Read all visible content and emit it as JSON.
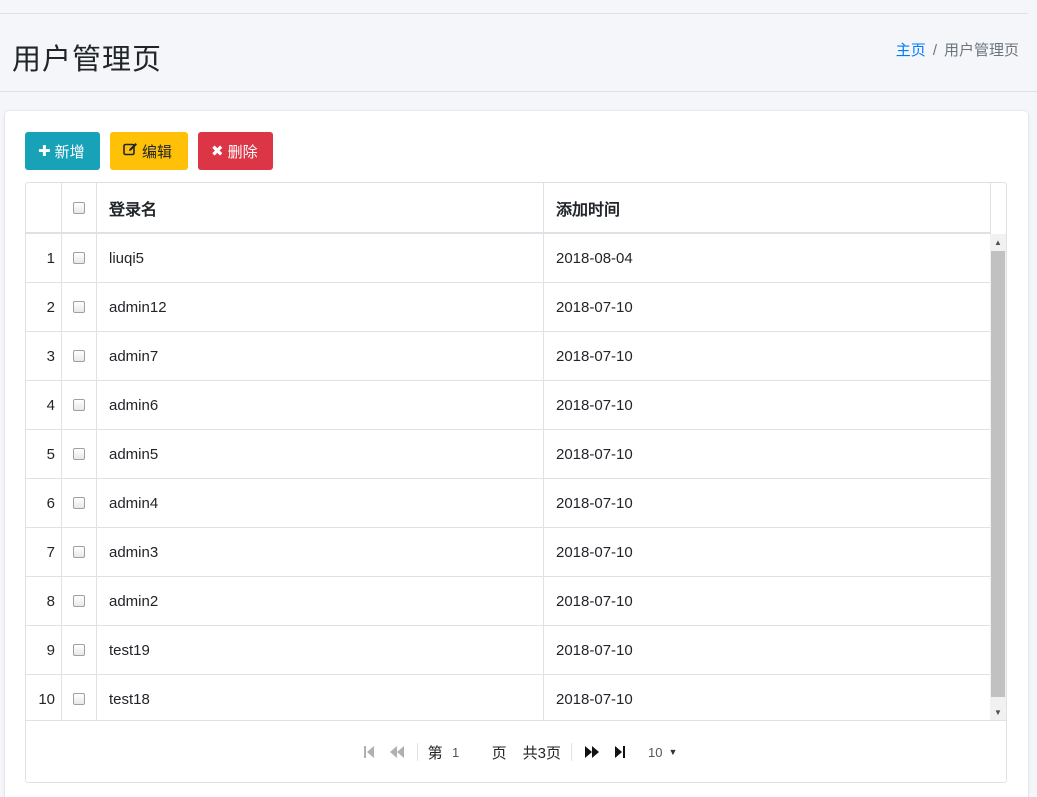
{
  "header": {
    "title": "用户管理页",
    "breadcrumb": {
      "home": "主页",
      "separator": "/",
      "current": "用户管理页"
    }
  },
  "toolbar": {
    "add": {
      "icon": "plus-icon",
      "label": "新增"
    },
    "edit": {
      "icon": "edit-icon",
      "label": "编辑"
    },
    "delete": {
      "icon": "close-icon",
      "label": "删除"
    }
  },
  "table": {
    "columns": {
      "login_name": "登录名",
      "added_time": "添加时间"
    },
    "rows": [
      {
        "no": "1",
        "login_name": "liuqi5",
        "added_time": "2018-08-04"
      },
      {
        "no": "2",
        "login_name": "admin12",
        "added_time": "2018-07-10"
      },
      {
        "no": "3",
        "login_name": "admin7",
        "added_time": "2018-07-10"
      },
      {
        "no": "4",
        "login_name": "admin6",
        "added_time": "2018-07-10"
      },
      {
        "no": "5",
        "login_name": "admin5",
        "added_time": "2018-07-10"
      },
      {
        "no": "6",
        "login_name": "admin4",
        "added_time": "2018-07-10"
      },
      {
        "no": "7",
        "login_name": "admin3",
        "added_time": "2018-07-10"
      },
      {
        "no": "8",
        "login_name": "admin2",
        "added_time": "2018-07-10"
      },
      {
        "no": "9",
        "login_name": "test19",
        "added_time": "2018-07-10"
      },
      {
        "no": "10",
        "login_name": "test18",
        "added_time": "2018-07-10"
      }
    ]
  },
  "pager": {
    "before_page": "第",
    "current_page": "1",
    "after_page": "页",
    "total": "共3页",
    "page_size": "10"
  },
  "colors": {
    "info": "#17a2b8",
    "warning": "#ffc107",
    "danger": "#dc3545",
    "link": "#007bff"
  }
}
